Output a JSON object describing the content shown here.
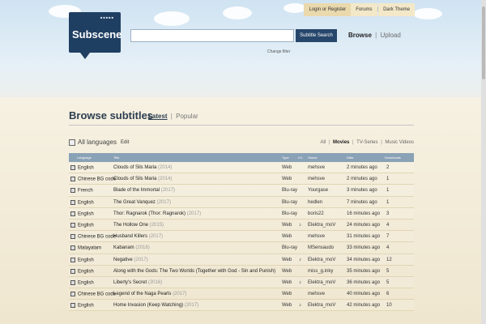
{
  "topbar": {
    "login": "Login or Register",
    "forums": "Forums",
    "sep": "|",
    "theme": "Dark Theme"
  },
  "logo": {
    "text": "Subscene",
    "dots": "■■■■■"
  },
  "search": {
    "value": "",
    "button": "Subtitle Search",
    "change_filter": "Change filter"
  },
  "nav": {
    "browse": "Browse",
    "sep": "|",
    "upload": "Upload"
  },
  "browse": {
    "title": "Browse subtitles",
    "tab_latest": "Latest",
    "sep": "|",
    "tab_popular": "Popular"
  },
  "language_filter": {
    "label": "All languages",
    "edit": "Edit"
  },
  "categories": {
    "all": "All",
    "sep": "|",
    "movies": "Movies",
    "tv": "TV-Series",
    "music": "Music Videos"
  },
  "table": {
    "headers": {
      "language": "Language",
      "title": "Title",
      "type": "Type",
      "hi": "H.I.",
      "owner": "Owner",
      "date": "Date",
      "downloads": "Downloads"
    },
    "rows": [
      {
        "language": "English",
        "title": "Clouds of Sils Maria",
        "year": "(2014)",
        "type": "Web",
        "hi": "",
        "owner": "mehsve",
        "date": "2 minutes ago",
        "downloads": "2"
      },
      {
        "language": "Chinese BG code",
        "title": "Clouds of Sils Maria",
        "year": "(2014)",
        "type": "Web",
        "hi": "",
        "owner": "mehsve",
        "date": "2 minutes ago",
        "downloads": "1"
      },
      {
        "language": "French",
        "title": "Blade of the Immortal",
        "year": "(2017)",
        "type": "Blu-ray",
        "hi": "",
        "owner": "Yourgase",
        "date": "3 minutes ago",
        "downloads": "1"
      },
      {
        "language": "English",
        "title": "The Great Vanquez",
        "year": "(2017)",
        "type": "Blu-ray",
        "hi": "",
        "owner": "hedlen",
        "date": "7 minutes ago",
        "downloads": "1"
      },
      {
        "language": "English",
        "title": "Thor: Ragnarok (Thor: Ragnarok)",
        "year": "(2017)",
        "type": "Blu-ray",
        "hi": "",
        "owner": "boris22",
        "date": "16 minutes ago",
        "downloads": "3"
      },
      {
        "language": "English",
        "title": "The Hollow One",
        "year": "(2015)",
        "type": "Web",
        "hi": "♪",
        "owner": "Elektra_moV",
        "date": "24 minutes ago",
        "downloads": "4"
      },
      {
        "language": "Chinese BG code",
        "title": "Husband Killers",
        "year": "(2017)",
        "type": "Web",
        "hi": "",
        "owner": "mehsve",
        "date": "31 minutes ago",
        "downloads": "7"
      },
      {
        "language": "Malayalam",
        "title": "Kabanam",
        "year": "(2016)",
        "type": "Blu-ray",
        "hi": "",
        "owner": "MSensaudo",
        "date": "33 minutes ago",
        "downloads": "4"
      },
      {
        "language": "English",
        "title": "Negative",
        "year": "(2017)",
        "type": "Web",
        "hi": "♪",
        "owner": "Elektra_moV",
        "date": "34 minutes ago",
        "downloads": "12"
      },
      {
        "language": "English",
        "title": "Along with the Gods: The Two Worlds (Together with God - Sin and Punish)",
        "year": "",
        "type": "Web",
        "hi": "",
        "owner": "miss_g.inky",
        "date": "35 minutes ago",
        "downloads": "5"
      },
      {
        "language": "English",
        "title": "Liberty's Secret",
        "year": "(2016)",
        "type": "Web",
        "hi": "♪",
        "owner": "Elektra_moV",
        "date": "36 minutes ago",
        "downloads": "5"
      },
      {
        "language": "Chinese BG code",
        "title": "Legend of the Naga Pearls",
        "year": "(2017)",
        "type": "Web",
        "hi": "",
        "owner": "mehsve",
        "date": "40 minutes ago",
        "downloads": "6"
      },
      {
        "language": "English",
        "title": "Home Invasion (Keep Watching)",
        "year": "(2017)",
        "type": "Web",
        "hi": "♪",
        "owner": "Elektra_moV",
        "date": "42 minutes ago",
        "downloads": "10"
      }
    ]
  }
}
